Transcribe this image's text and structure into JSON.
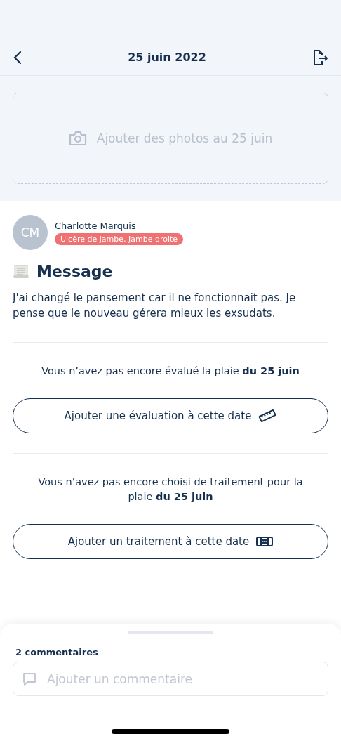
{
  "header": {
    "title": "25 juin 2022"
  },
  "photos": {
    "label": "Ajouter des photos au 25 juin"
  },
  "author": {
    "initials": "CM",
    "name": "Charlotte Marquis",
    "tag": "Ulcère de jambe, Jambe droite"
  },
  "message": {
    "title": "Message",
    "body": "J'ai changé le pansement car il ne fonctionnait pas. Je pense que le nouveau gérera mieux les exsudats."
  },
  "prompts": [
    {
      "text": "Vous n’avez pas encore évalué la plaie **du 25 juin**",
      "button": "Ajouter une évaluation à cette date",
      "kind": "ruler"
    },
    {
      "text": "Vous n’avez pas encore choisi de traitement pour la plaie **du 25 juin**",
      "button": "Ajouter un traitement à cette date",
      "kind": "bandage"
    }
  ],
  "comments": {
    "count": "2 commentaires",
    "placeholder": "Ajouter un commentaire"
  }
}
